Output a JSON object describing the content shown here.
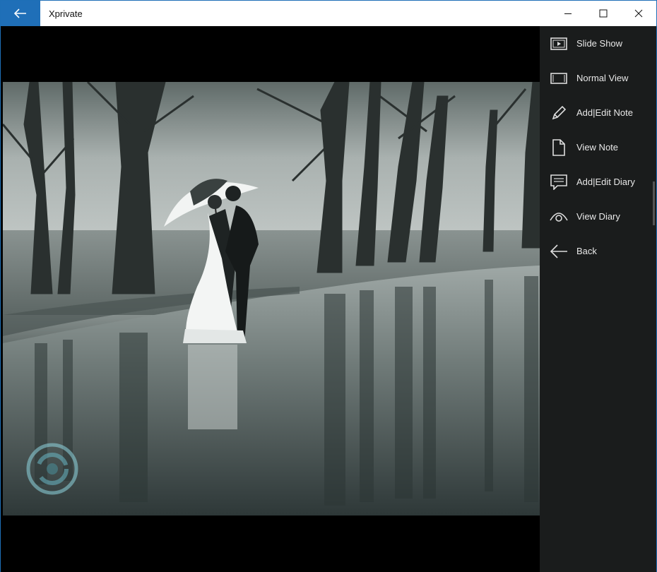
{
  "window": {
    "title": "Xprivate"
  },
  "titlebar": {
    "back_icon": "arrow-left-icon",
    "controls": [
      {
        "name": "minimize",
        "icon": "minimize-icon"
      },
      {
        "name": "maximize",
        "icon": "maximize-icon"
      },
      {
        "name": "close",
        "icon": "close-icon"
      }
    ]
  },
  "menu": {
    "items": [
      {
        "label": "Slide Show",
        "icon": "slideshow-icon"
      },
      {
        "label": "Normal View",
        "icon": "normal-view-icon"
      },
      {
        "label": "Add|Edit Note",
        "icon": "pencil-icon"
      },
      {
        "label": "View Note",
        "icon": "document-icon"
      },
      {
        "label": "Add|Edit Diary",
        "icon": "diary-icon"
      },
      {
        "label": "View Diary",
        "icon": "eye-icon"
      },
      {
        "label": "Back",
        "icon": "arrow-left-icon"
      }
    ]
  },
  "colors": {
    "accent": "#1f6fb8",
    "menu_bg": "#1c1e1e",
    "menu_text": "#e8e8e8"
  }
}
